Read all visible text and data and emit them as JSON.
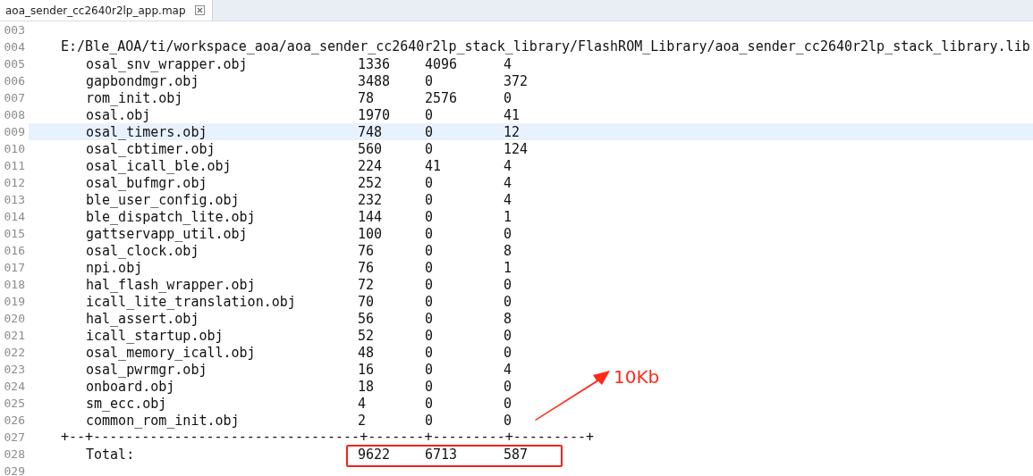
{
  "tab": {
    "title": "aoa_sender_cc2640r2lp_app.map",
    "selected": true
  },
  "editor": {
    "lines": [
      {
        "number": "003",
        "kind": "blank",
        "current": false
      },
      {
        "number": "004",
        "kind": "path",
        "text": "E:/Ble_AOA/ti/workspace_aoa/aoa_sender_cc2640r2lp_stack_library/FlashROM_Library/aoa_sender_cc2640r2lp_stack_library.lib",
        "current": false
      },
      {
        "number": "005",
        "kind": "row",
        "name": "osal_snv_wrapper.obj",
        "values": [
          "1336",
          "4096",
          "4"
        ],
        "current": false
      },
      {
        "number": "006",
        "kind": "row",
        "name": "gapbondmgr.obj",
        "values": [
          "3488",
          "0",
          "372"
        ],
        "current": false
      },
      {
        "number": "007",
        "kind": "row",
        "name": "rom_init.obj",
        "values": [
          "78",
          "2576",
          "0"
        ],
        "current": false
      },
      {
        "number": "008",
        "kind": "row",
        "name": "osal.obj",
        "values": [
          "1970",
          "0",
          "41"
        ],
        "current": false
      },
      {
        "number": "009",
        "kind": "row",
        "name": "osal_timers.obj",
        "values": [
          "748",
          "0",
          "12"
        ],
        "current": true
      },
      {
        "number": "010",
        "kind": "row",
        "name": "osal_cbtimer.obj",
        "values": [
          "560",
          "0",
          "124"
        ],
        "current": false
      },
      {
        "number": "011",
        "kind": "row",
        "name": "osal_icall_ble.obj",
        "values": [
          "224",
          "41",
          "4"
        ],
        "current": false
      },
      {
        "number": "012",
        "kind": "row",
        "name": "osal_bufmgr.obj",
        "values": [
          "252",
          "0",
          "4"
        ],
        "current": false
      },
      {
        "number": "013",
        "kind": "row",
        "name": "ble_user_config.obj",
        "values": [
          "232",
          "0",
          "4"
        ],
        "current": false
      },
      {
        "number": "014",
        "kind": "row",
        "name": "ble_dispatch_lite.obj",
        "values": [
          "144",
          "0",
          "1"
        ],
        "current": false
      },
      {
        "number": "015",
        "kind": "row",
        "name": "gattservapp_util.obj",
        "values": [
          "100",
          "0",
          "0"
        ],
        "current": false
      },
      {
        "number": "016",
        "kind": "row",
        "name": "osal_clock.obj",
        "values": [
          "76",
          "0",
          "8"
        ],
        "current": false
      },
      {
        "number": "017",
        "kind": "row",
        "name": "npi.obj",
        "values": [
          "76",
          "0",
          "1"
        ],
        "current": false
      },
      {
        "number": "018",
        "kind": "row",
        "name": "hal_flash_wrapper.obj",
        "values": [
          "72",
          "0",
          "0"
        ],
        "current": false
      },
      {
        "number": "019",
        "kind": "row",
        "name": "icall_lite_translation.obj",
        "values": [
          "70",
          "0",
          "0"
        ],
        "current": false
      },
      {
        "number": "020",
        "kind": "row",
        "name": "hal_assert.obj",
        "values": [
          "56",
          "0",
          "8"
        ],
        "current": false
      },
      {
        "number": "021",
        "kind": "row",
        "name": "icall_startup.obj",
        "values": [
          "52",
          "0",
          "0"
        ],
        "current": false
      },
      {
        "number": "022",
        "kind": "row",
        "name": "osal_memory_icall.obj",
        "values": [
          "48",
          "0",
          "0"
        ],
        "current": false
      },
      {
        "number": "023",
        "kind": "row",
        "name": "osal_pwrmgr.obj",
        "values": [
          "16",
          "0",
          "4"
        ],
        "current": false
      },
      {
        "number": "024",
        "kind": "row",
        "name": "onboard.obj",
        "values": [
          "18",
          "0",
          "0"
        ],
        "current": false
      },
      {
        "number": "025",
        "kind": "row",
        "name": "sm_ecc.obj",
        "values": [
          "4",
          "0",
          "0"
        ],
        "current": false
      },
      {
        "number": "026",
        "kind": "row",
        "name": "common_rom_init.obj",
        "values": [
          "2",
          "0",
          "0"
        ],
        "current": false
      },
      {
        "number": "027",
        "kind": "separator",
        "text": "+--+---------------------------------+-------+---------+---------+",
        "current": false
      },
      {
        "number": "028",
        "kind": "total",
        "name": "Total:",
        "values": [
          "9622",
          "6713",
          "587"
        ],
        "current": false
      },
      {
        "number": "029",
        "kind": "blank",
        "current": false
      }
    ]
  },
  "annotation": {
    "label": "10Kb"
  }
}
